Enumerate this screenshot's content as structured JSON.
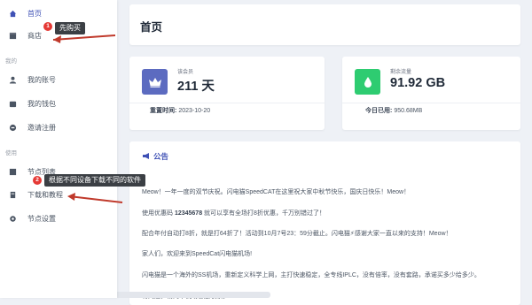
{
  "sidebar": {
    "items": [
      {
        "label": "首页",
        "icon": "home-icon",
        "active": true
      },
      {
        "label": "商店",
        "icon": "store-icon",
        "active": false
      }
    ],
    "section_mine": "我的",
    "mine_items": [
      {
        "label": "我的账号",
        "icon": "user-icon"
      },
      {
        "label": "我的钱包",
        "icon": "wallet-icon"
      },
      {
        "label": "邀请注册",
        "icon": "invite-icon"
      }
    ],
    "section_use": "使用",
    "use_items": [
      {
        "label": "节点列表",
        "icon": "list-icon"
      },
      {
        "label": "下载和教程",
        "icon": "book-icon"
      },
      {
        "label": "节点设置",
        "icon": "gear-icon"
      }
    ]
  },
  "header": {
    "title": "首页"
  },
  "stats": [
    {
      "label": "该会员",
      "value": "211 天",
      "foot_label": "重置时间:",
      "foot_value": "2023-10-20",
      "icon": "crown-icon",
      "color": "#5c6bc0"
    },
    {
      "label": "剩余流量",
      "value": "91.92 GB",
      "foot_label": "今日已用:",
      "foot_value": "950.68MB",
      "icon": "drop-icon",
      "color": "#2ecc71"
    }
  ],
  "announcement": {
    "title": "公告",
    "lines": [
      {
        "text": "Meow！一年一度的双节庆祝。闪电猫SpeedCAT在这里祝大家中秋节快乐，国庆日快乐！Meow！"
      },
      {
        "prefix": "使用优惠码 ",
        "code": "12345678",
        "suffix": " 就可以享有全场打8折优惠，千万别错过了！"
      },
      {
        "text": "配合年付自动打8折，就是打64折了！活动到10月7号23：59分截止。闪电猫⚡感谢大家一直以来的支持！Meow！"
      },
      {
        "text": "家人们，欢迎来到SpeedCat闪电猫机场!"
      },
      {
        "text": "闪电猫是一个海外的SS机场，重新定义科学上网，主打快速稳定，全专线IPLC，没有倍率，没有套路，承诺买多少给多少。"
      },
      {
        "text": "有问题，请向本机场客服联系。"
      }
    ]
  },
  "annotations": [
    {
      "num": "1",
      "text": "先购买"
    },
    {
      "num": "2",
      "text": "根据不同设备下载不同的软件"
    }
  ],
  "colors": {
    "accent": "#3f51b5",
    "annotation_arrow": "#c0392b",
    "badge": "#e53935"
  }
}
